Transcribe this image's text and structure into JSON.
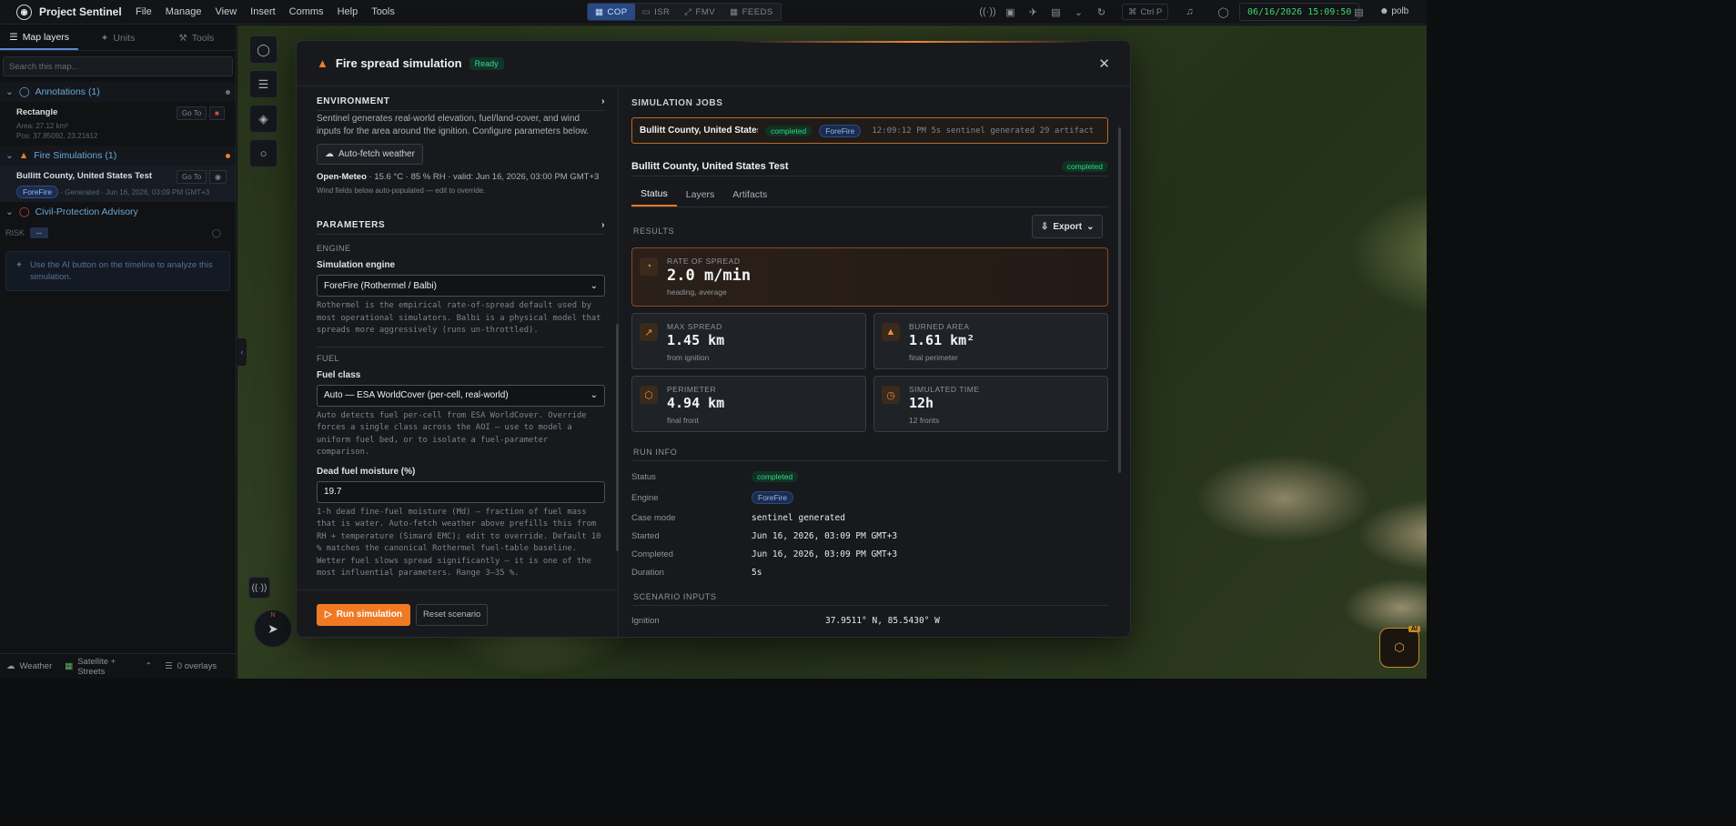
{
  "app": {
    "title": "Project Sentinel",
    "menu": [
      "File",
      "Manage",
      "View",
      "Insert",
      "Comms",
      "Help",
      "Tools"
    ],
    "modes": [
      {
        "label": "COP",
        "active": true
      },
      {
        "label": "ISR",
        "active": false
      },
      {
        "label": "FMV",
        "active": false
      },
      {
        "label": "FEEDS",
        "active": false
      }
    ],
    "shortcut": "Ctrl P",
    "clock": "06/16/2026 15:09:50",
    "user": "polb"
  },
  "sidebar": {
    "tabs": [
      "Map layers",
      "Units",
      "Tools"
    ],
    "search_placeholder": "Search this map...",
    "annotations": {
      "header": "Annotations (1)",
      "item": {
        "title": "Rectangle",
        "area": "Area: 27.12 km²",
        "pos": "Pos: 37.85092, 23.21612",
        "goto": "Go To"
      }
    },
    "fire_sims": {
      "header": "Fire Simulations (1)",
      "item": {
        "title": "Bullitt County, United States Test",
        "engine": "ForeFire",
        "meta": "· Generated · Jun 16, 2026, 03:09 PM GMT+3",
        "goto": "Go To"
      }
    },
    "advisory": {
      "header": "Civil-Protection Advisory",
      "risk_label": "RISK",
      "risk_value": "--",
      "hint": "Use the AI button on the timeline to analyze this simulation."
    },
    "footer": {
      "weather": "Weather",
      "basemap": "Satellite + Streets",
      "overlays": "0 overlays"
    }
  },
  "map": {
    "ai_label": "AI",
    "compass_n": "N"
  },
  "modal": {
    "title": "Fire spread simulation",
    "status": "Ready",
    "environment": {
      "title": "ENVIRONMENT",
      "desc": "Sentinel generates real-world elevation, fuel/land-cover, and wind inputs for the area around the ignition. Configure parameters below.",
      "fetch_btn": "Auto-fetch weather",
      "weather_src": "Open-Meteo",
      "weather_line": " · 15.6 °C · 85 % RH · valid: Jun 16, 2026, 03:00 PM GMT+3",
      "wind_note": "Wind fields below auto-populated — edit to override."
    },
    "parameters": {
      "title": "PARAMETERS",
      "engine_sub": "ENGINE",
      "engine_label": "Simulation engine",
      "engine_value": "ForeFire (Rothermel / Balbi)",
      "engine_desc": "Rothermel is the empirical rate-of-spread default used by most operational simulators. Balbi is a physical model that spreads more aggressively (runs un-throttled).",
      "fuel_sub": "FUEL",
      "fuel_label": "Fuel class",
      "fuel_value": "Auto — ESA WorldCover (per-cell, real-world)",
      "fuel_desc": "Auto detects fuel per-cell from ESA WorldCover. Override forces a single class across the AOI — use to model a uniform fuel bed, or to isolate a fuel-parameter comparison.",
      "moisture_label": "Dead fuel moisture (%)",
      "moisture_value": "19.7",
      "moisture_desc": "1-h dead fine-fuel moisture (Md) — fraction of fuel mass that is water. Auto-fetch weather above prefills this from RH + temperature (Simard EMC); edit to override. Default 10 % matches the canonical Rothermel fuel-table baseline. Wetter fuel slows spread significantly — it is one of the most influential parameters. Range 3–35 %."
    },
    "buttons": {
      "run": "Run simulation",
      "reset": "Reset scenario"
    },
    "jobs": {
      "title": "SIMULATION JOBS",
      "row": {
        "name": "Bullitt County, United States...",
        "status": "completed",
        "engine": "ForeFire",
        "tail": "12:09:12 PM 5s sentinel generated 29 artifact"
      }
    },
    "detail": {
      "name": "Bullitt County, United States Test",
      "status": "completed",
      "tabs": [
        "Status",
        "Layers",
        "Artifacts"
      ],
      "results_title": "RESULTS",
      "export": "Export",
      "stats": {
        "ros": {
          "label": "RATE OF SPREAD",
          "value": "2.0 m/min",
          "sub": "heading, average"
        },
        "max_spread": {
          "label": "MAX SPREAD",
          "value": "1.45 km",
          "sub": "from ignition"
        },
        "burned": {
          "label": "BURNED AREA",
          "value": "1.61 km²",
          "sub": "final perimeter"
        },
        "perimeter": {
          "label": "PERIMETER",
          "value": "4.94 km",
          "sub": "final front"
        },
        "sim_time": {
          "label": "SIMULATED TIME",
          "value": "12h",
          "sub": "12 fronts"
        }
      },
      "run_info_title": "RUN INFO",
      "run_info": {
        "status_label": "Status",
        "status": "completed",
        "engine_label": "Engine",
        "engine": "ForeFire",
        "case_label": "Case mode",
        "case": "sentinel generated",
        "started_label": "Started",
        "started": "Jun 16, 2026, 03:09 PM GMT+3",
        "completed_label": "Completed",
        "completed": "Jun 16, 2026, 03:09 PM GMT+3",
        "duration_label": "Duration",
        "duration": "5s"
      },
      "scenario_title": "SCENARIO INPUTS",
      "ignition_label": "Ignition",
      "ignition": "37.9511° N, 85.5430° W"
    }
  }
}
